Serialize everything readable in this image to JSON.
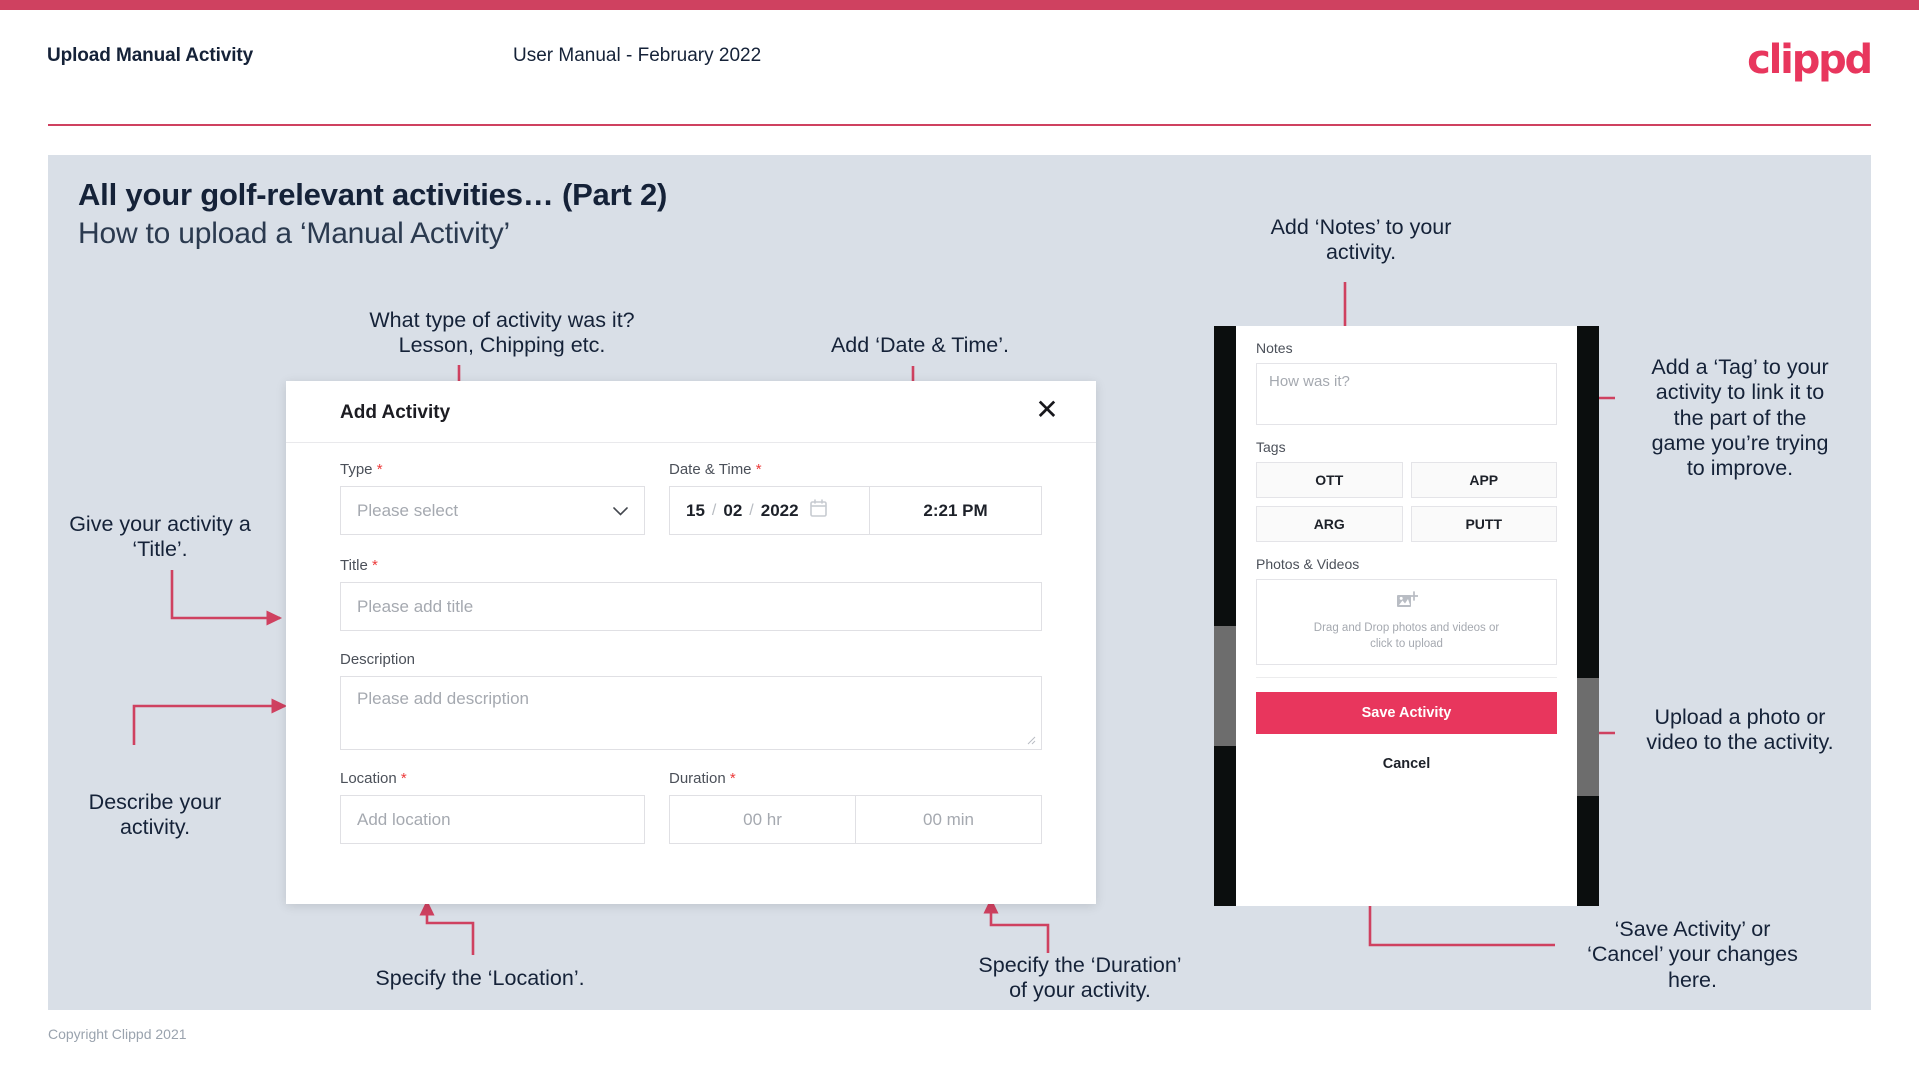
{
  "header": {
    "title": "Upload Manual Activity",
    "subtitle": "User Manual - February 2022",
    "logo": "clippd"
  },
  "slide": {
    "title": "All your golf-relevant activities… (Part 2)",
    "subtitle": "How to upload a ‘Manual Activity’"
  },
  "footer": {
    "copyright": "Copyright Clippd 2021"
  },
  "colors": {
    "brand": "#e8365d",
    "topbar": "#cf4160",
    "slide_bg": "#d9dfe7",
    "text_dark": "#152238",
    "required": "#ec3a3a",
    "arrow": "#cf4160"
  },
  "dialog": {
    "title": "Add Activity",
    "close_icon": "close-icon",
    "fields": {
      "type": {
        "label": "Type",
        "required": "*",
        "placeholder": "Please select",
        "chevron": "⌄"
      },
      "datetime": {
        "label": "Date & Time",
        "required": "*",
        "day": "15",
        "month": "02",
        "year": "2022",
        "sep": "/",
        "time": "2:21 PM"
      },
      "title": {
        "label": "Title",
        "required": "*",
        "placeholder": "Please add title"
      },
      "description": {
        "label": "Description",
        "placeholder": "Please add description"
      },
      "location": {
        "label": "Location",
        "required": "*",
        "placeholder": "Add location"
      },
      "duration": {
        "label": "Duration",
        "required": "*",
        "hours_placeholder": "00 hr",
        "minutes_placeholder": "00 min"
      }
    }
  },
  "phone": {
    "notes": {
      "label": "Notes",
      "placeholder": "How was it?"
    },
    "tags": {
      "label": "Tags",
      "items": [
        "OTT",
        "APP",
        "ARG",
        "PUTT"
      ]
    },
    "photos": {
      "label": "Photos & Videos",
      "icon": "add-image-icon",
      "dropzone_line1": "Drag and Drop photos and videos or",
      "dropzone_line2": "click to upload"
    },
    "save_label": "Save Activity",
    "cancel_label": "Cancel"
  },
  "annotations": {
    "type": "What type of activity was it?\nLesson, Chipping etc.",
    "datetime": "Add ‘Date & Time’.",
    "title": "Give your activity a\n‘Title’.",
    "description": "Describe your\nactivity.",
    "location": "Specify the ‘Location’.",
    "duration": "Specify the ‘Duration’\nof your activity.",
    "notes": "Add ‘Notes’ to your\nactivity.",
    "tags": "Add a ‘Tag’ to your\nactivity to link it to\nthe part of the\ngame you’re trying\nto improve.",
    "upload": "Upload a photo or\nvideo to the activity.",
    "save": "‘Save Activity’ or\n‘Cancel’ your changes\nhere."
  }
}
